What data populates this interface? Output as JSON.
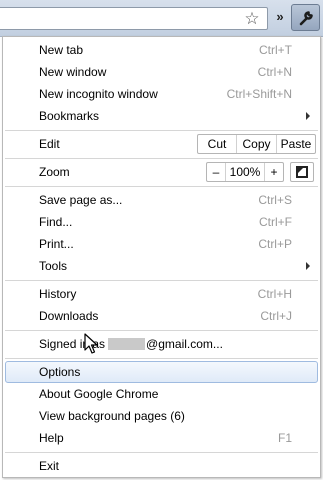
{
  "toolbar": {
    "star": "☆",
    "chevron": "»"
  },
  "menu": {
    "new_tab": {
      "label": "New tab",
      "shortcut": "Ctrl+T"
    },
    "new_window": {
      "label": "New window",
      "shortcut": "Ctrl+N"
    },
    "new_incognito": {
      "label": "New incognito window",
      "shortcut": "Ctrl+Shift+N"
    },
    "bookmarks": {
      "label": "Bookmarks"
    },
    "edit": {
      "label": "Edit",
      "cut": "Cut",
      "copy": "Copy",
      "paste": "Paste"
    },
    "zoom": {
      "label": "Zoom",
      "minus": "–",
      "value": "100%",
      "plus": "+"
    },
    "save_page": {
      "label": "Save page as...",
      "shortcut": "Ctrl+S"
    },
    "find": {
      "label": "Find...",
      "shortcut": "Ctrl+F"
    },
    "print": {
      "label": "Print...",
      "shortcut": "Ctrl+P"
    },
    "tools": {
      "label": "Tools"
    },
    "history": {
      "label": "History",
      "shortcut": "Ctrl+H"
    },
    "downloads": {
      "label": "Downloads",
      "shortcut": "Ctrl+J"
    },
    "signed_in": {
      "prefix": "Signed in as",
      "suffix": "@gmail.com..."
    },
    "options": {
      "label": "Options"
    },
    "about": {
      "label": "About Google Chrome"
    },
    "background_pages": {
      "label": "View background pages (6)"
    },
    "help": {
      "label": "Help",
      "shortcut": "F1"
    },
    "exit": {
      "label": "Exit"
    }
  }
}
